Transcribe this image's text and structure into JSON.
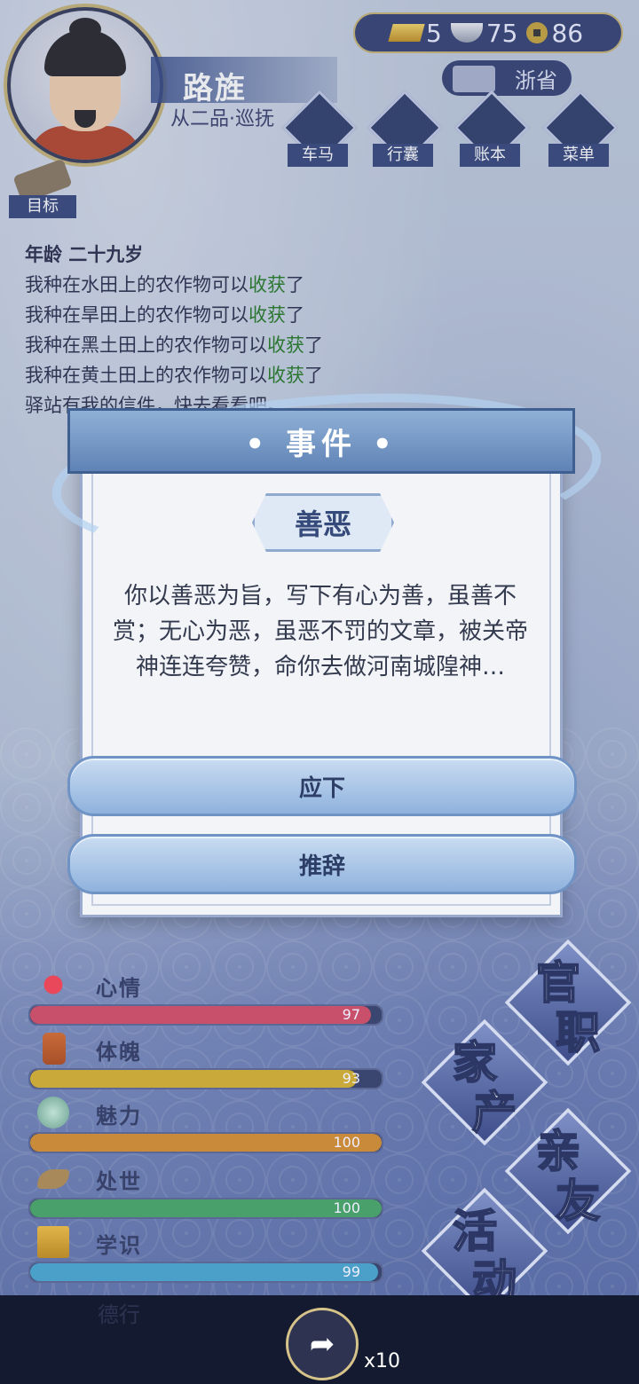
{
  "player": {
    "name": "路旌",
    "rank": "从二品·巡抚"
  },
  "currency": {
    "gold": "5",
    "silver": "75",
    "copper": "86"
  },
  "location": "浙省",
  "nav": [
    "车马",
    "行囊",
    "账本",
    "菜单"
  ],
  "goal_label": "目标",
  "log": {
    "age": "年龄 二十九岁",
    "lines": [
      {
        "pre": "我种在水田上的农作物可以",
        "hl": "收获",
        "post": "了"
      },
      {
        "pre": "我种在旱田上的农作物可以",
        "hl": "收获",
        "post": "了"
      },
      {
        "pre": "我种在黑土田上的农作物可以",
        "hl": "收获",
        "post": "了"
      },
      {
        "pre": "我种在黄土田上的农作物可以",
        "hl": "收获",
        "post": "了"
      }
    ],
    "extra": "驿站有我的信件，快去看看吧。"
  },
  "modal": {
    "header": "• 事件 •",
    "title": "善恶",
    "text": "你以善恶为旨，写下有心为善，虽善不赏；无心为恶，虽恶不罚的文章，被关帝神连连夸赞，命你去做河南城隍神…",
    "accept": "应下",
    "decline": "推辞"
  },
  "stats": [
    {
      "name": "心情",
      "value": "97",
      "pct": 97,
      "color": "#c8506a",
      "icon": "flower-icon"
    },
    {
      "name": "体魄",
      "value": "93",
      "pct": 93,
      "color": "#c9a93a",
      "icon": "body-icon"
    },
    {
      "name": "魅力",
      "value": "100",
      "pct": 100,
      "color": "#c98a3a",
      "icon": "charm-icon"
    },
    {
      "name": "处世",
      "value": "100",
      "pct": 100,
      "color": "#4aa06a",
      "icon": "conduct-icon"
    },
    {
      "name": "学识",
      "value": "99",
      "pct": 99,
      "color": "#4aa0c8",
      "icon": "knowledge-icon"
    }
  ],
  "virtue_label": "德行",
  "big_buttons": {
    "official": [
      "官",
      "职"
    ],
    "family": [
      "家",
      "产"
    ],
    "friends": [
      "亲",
      "友"
    ],
    "activity": [
      "活",
      "动"
    ]
  },
  "bottom": {
    "multiplier": "x10"
  }
}
